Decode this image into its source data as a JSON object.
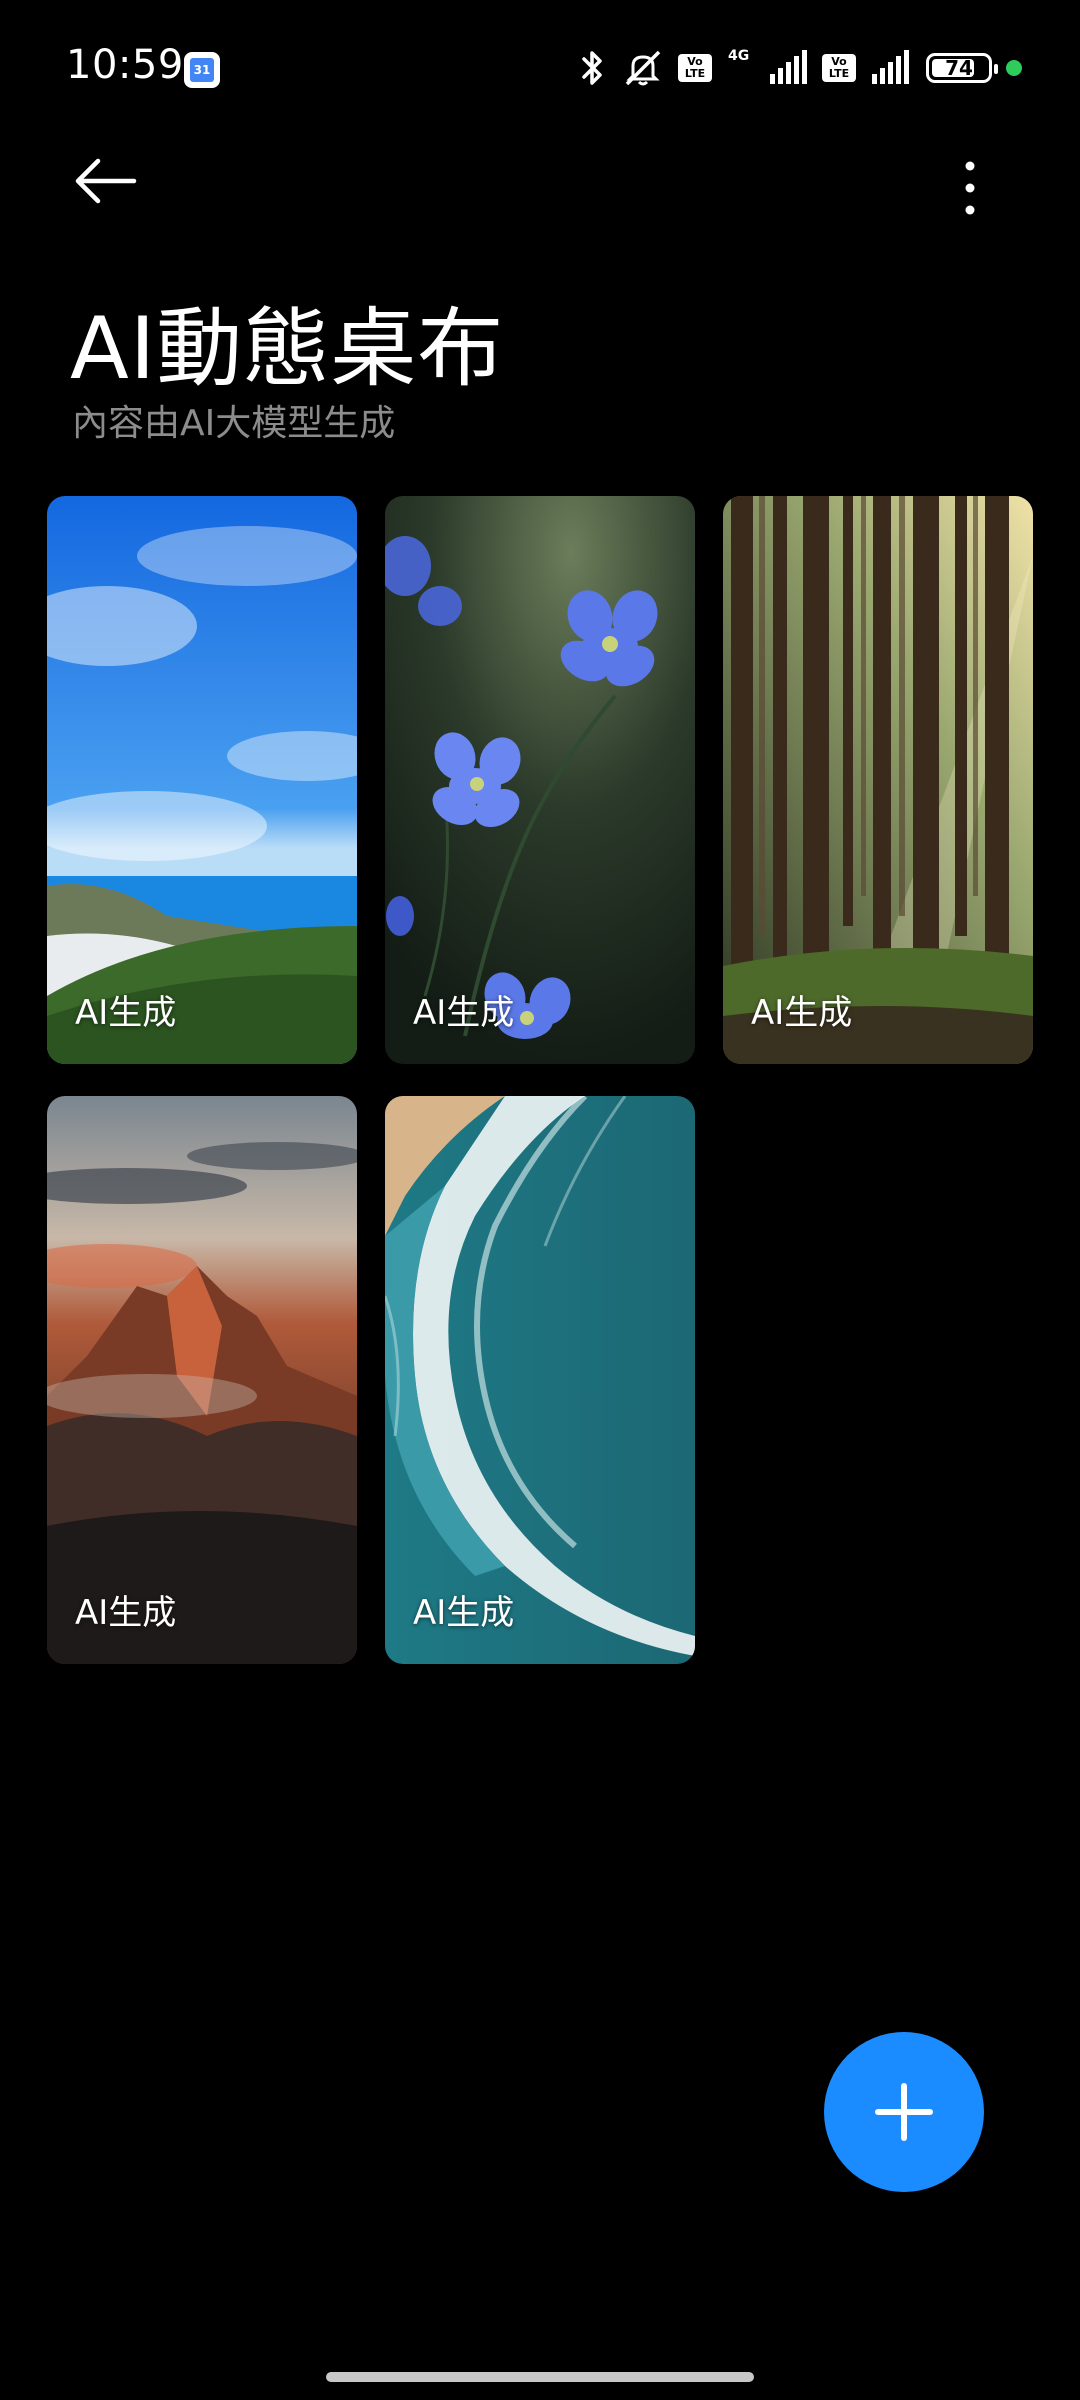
{
  "status_bar": {
    "time": "10:59",
    "calendar_icon_text": "31",
    "network": "4G",
    "volte": [
      "Vo",
      "LTE"
    ],
    "battery_level": "74",
    "icons": [
      "bluetooth-icon",
      "mute-icon",
      "volte-icon",
      "signal-icon",
      "battery-icon",
      "privacy-dot-icon"
    ]
  },
  "header": {
    "back_icon": "arrow-left-icon",
    "more_icon": "more-vertical-icon",
    "title": "AI動態桌布",
    "subtitle": "內容由AI大模型生成"
  },
  "wallpapers": [
    {
      "label": "AI生成",
      "scene": "sky-coast"
    },
    {
      "label": "AI生成",
      "scene": "blue-flowers"
    },
    {
      "label": "AI生成",
      "scene": "forest"
    },
    {
      "label": "AI生成",
      "scene": "mountain-sunset"
    },
    {
      "label": "AI生成",
      "scene": "ocean-waves"
    }
  ],
  "fab": {
    "icon": "plus-icon"
  },
  "colors": {
    "background": "#000000",
    "accent": "#1a8cff",
    "subtitle": "#8c8c8c"
  }
}
